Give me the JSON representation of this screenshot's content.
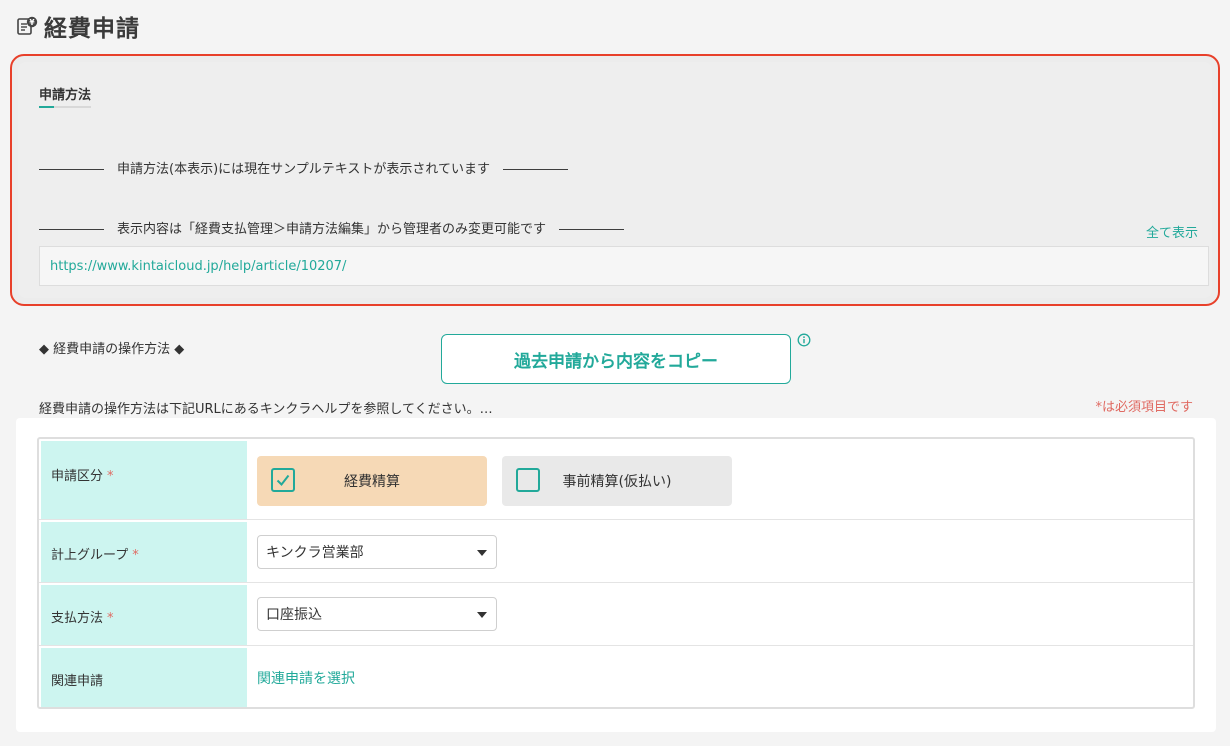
{
  "page": {
    "title": "経費申請"
  },
  "method_section": {
    "heading": "申請方法",
    "description_lines": [
      "―――――　申請方法(本表示)には現在サンプルテキストが表示されています　―――――",
      "―――――　表示内容は「経費支払管理＞申請方法編集」から管理者のみ変更可能です　―――――",
      "",
      "◆ 経費申請の操作方法 ◆",
      "経費申請の操作方法は下記URLにあるキンクラヘルプを参照してください。…"
    ],
    "show_all_label": "全て表示",
    "url": "https://www.kintaicloud.jp/help/article/10207/"
  },
  "copy_button": {
    "label": "過去申請から内容をコピー"
  },
  "required_note": "*は必須項目です",
  "form": {
    "request_type": {
      "label": "申請区分",
      "required_mark": "*",
      "options": [
        {
          "label": "経費精算",
          "checked": true
        },
        {
          "label": "事前精算(仮払い)",
          "checked": false
        }
      ]
    },
    "accounting_group": {
      "label": "計上グループ",
      "required_mark": "*",
      "value": "キンクラ営業部"
    },
    "payment_method": {
      "label": "支払方法",
      "required_mark": "*",
      "value": "口座振込"
    },
    "related_request": {
      "label": "関連申請",
      "action_label": "関連申請を選択"
    }
  },
  "colors": {
    "accent": "#22a99a",
    "highlight_border": "#e8402a",
    "label_bg": "#cdf5f0",
    "selected_option_bg": "#f6d9b6",
    "required": "#e06a62"
  }
}
